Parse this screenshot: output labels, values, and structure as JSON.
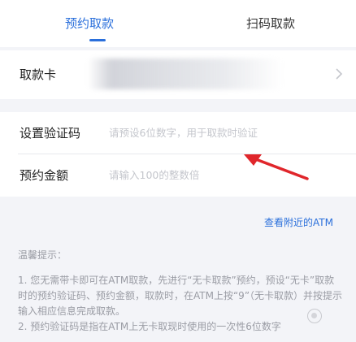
{
  "tabs": [
    {
      "label": "预约取款",
      "active": true
    },
    {
      "label": "扫码取款",
      "active": false
    }
  ],
  "card": {
    "label": "取款卡",
    "chevron": "chevron-right-icon"
  },
  "form": {
    "code_label": "设置验证码",
    "code_placeholder": "请预设6位数字，用于取款时验证",
    "amount_label": "预约金额",
    "amount_placeholder": "请输入100的整数倍"
  },
  "atm_link": "查看附近的ATM",
  "tips": {
    "title": "温馨提示：",
    "items": [
      "1. 您无需带卡即可在ATM取款，先进行“无卡取款”预约，预设“无卡”取款时的预约验证码、预约金额，取款时，在ATM上按“9”（无卡取款）并按提示输入相应信息完成取款。",
      "2. 预约验证码是指在ATM上无卡取现时使用的一次性6位数字"
    ]
  },
  "colors": {
    "accent": "#2a6fdb",
    "annotation_arrow": "#e0262b",
    "background": "#f3f4f8"
  }
}
